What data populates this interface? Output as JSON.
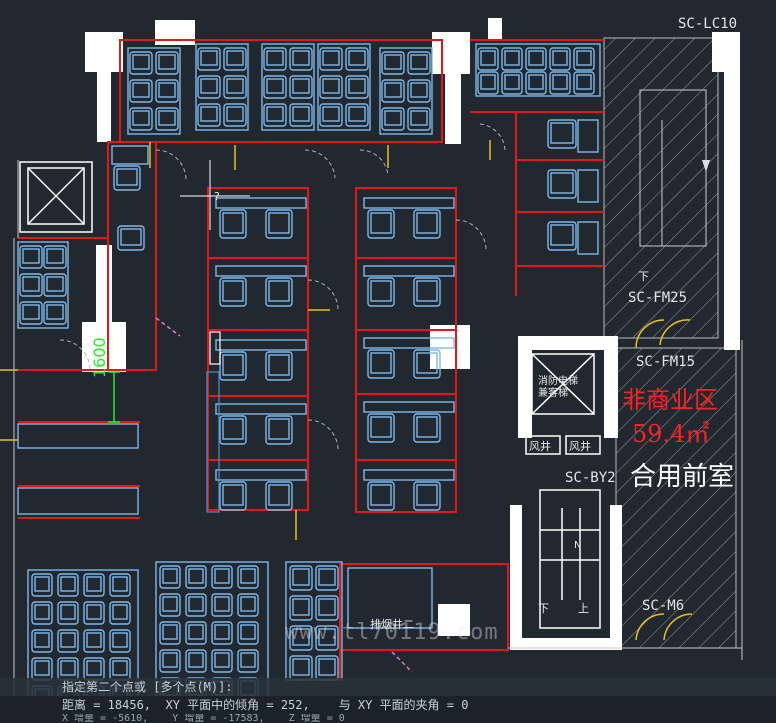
{
  "labels": {
    "sc_lc10": "SC-LC10",
    "sc_fm25": "SC-FM25",
    "sc_fm15": "SC-FM15",
    "sc_by2": "SC-BY2",
    "sc_m6": "SC-M6",
    "down_1": "下",
    "down_2": "下",
    "up": "上",
    "area_title": "非商业区",
    "area_value": "59.4㎡",
    "area_sub": "合用前室",
    "fan_well_1": "风井",
    "fan_well_2": "风井",
    "elevator": "消防电梯\n兼客梯",
    "stair_n": "N",
    "dimension": "1600",
    "hoist_room": "排烟井二",
    "question": "?"
  },
  "watermark": "www.tl70119.com",
  "command": {
    "prompt": "指定第二个点或 [多个点(M)]:",
    "result": "距离 = 18456,  XY 平面中的倾角 = 252,    与 XY 平面的夹角 = 0",
    "partial": "X 增量 = -5610,    Y 增量 = -17583,    Z 增量 = 0"
  },
  "colors": {
    "background": "#212830",
    "wall": "#e01818",
    "furniture": "#7fb8e8",
    "white_wall": "#ffffff",
    "door": "#e8c020",
    "dimension": "#22ee22",
    "accent_red": "#ff2020"
  }
}
